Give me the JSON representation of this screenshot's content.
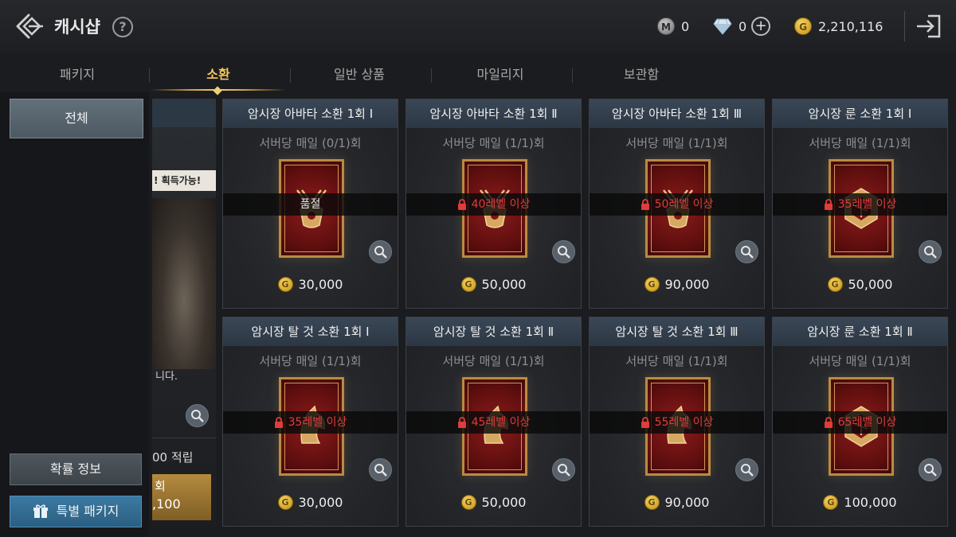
{
  "header": {
    "title": "캐시샵",
    "mileage_icon_text": "M",
    "mileage": "0",
    "diamond": "0",
    "gold_icon_text": "G",
    "gold": "2,210,116"
  },
  "tabs": [
    {
      "label": "패키지",
      "active": false
    },
    {
      "label": "소환",
      "active": true
    },
    {
      "label": "일반 상품",
      "active": false
    },
    {
      "label": "마일리지",
      "active": false
    },
    {
      "label": "보관함",
      "active": false
    }
  ],
  "sidebar": {
    "category_all": "전체",
    "probability_info": "확률 정보",
    "special_package": "특별 패키지"
  },
  "banner": {
    "tag": "! 획득가능!",
    "description": "니다.",
    "earn": "00 적립",
    "gold_label": "회",
    "gold_price": ",100"
  },
  "products": [
    {
      "name": "암시장 아바타 소환 1회 Ⅰ",
      "limit": "서버당 매일 (0/1)회",
      "status": "품절",
      "locked": false,
      "price": "30,000",
      "emblem": "sword"
    },
    {
      "name": "암시장 아바타 소환 1회 Ⅱ",
      "limit": "서버당 매일 (1/1)회",
      "status": "40레벨 이상",
      "locked": true,
      "price": "50,000",
      "emblem": "sword"
    },
    {
      "name": "암시장 아바타 소환 1회 Ⅲ",
      "limit": "서버당 매일 (1/1)회",
      "status": "50레벨 이상",
      "locked": true,
      "price": "90,000",
      "emblem": "sword"
    },
    {
      "name": "암시장 룬 소환 1회 Ⅰ",
      "limit": "서버당 매일 (1/1)회",
      "status": "35레벨 이상",
      "locked": true,
      "price": "50,000",
      "emblem": "rune"
    },
    {
      "name": "암시장 탈 것 소환 1회 Ⅰ",
      "limit": "서버당 매일 (1/1)회",
      "status": "35레벨 이상",
      "locked": true,
      "price": "30,000",
      "emblem": "horse"
    },
    {
      "name": "암시장 탈 것 소환 1회 Ⅱ",
      "limit": "서버당 매일 (1/1)회",
      "status": "45레벨 이상",
      "locked": true,
      "price": "50,000",
      "emblem": "horse"
    },
    {
      "name": "암시장 탈 것 소환 1회 Ⅲ",
      "limit": "서버당 매일 (1/1)회",
      "status": "55레벨 이상",
      "locked": true,
      "price": "90,000",
      "emblem": "horse"
    },
    {
      "name": "암시장 룬 소환 1회 Ⅱ",
      "limit": "서버당 매일 (1/1)회",
      "status": "65레벨 이상",
      "locked": true,
      "price": "100,000",
      "emblem": "rune"
    }
  ],
  "colors": {
    "accent_gold": "#f1c760",
    "locked_red": "#e03c3c",
    "card_header": "#3a4756",
    "sidebar_selected": "#5a6770",
    "special_button": "#3b79a1"
  }
}
